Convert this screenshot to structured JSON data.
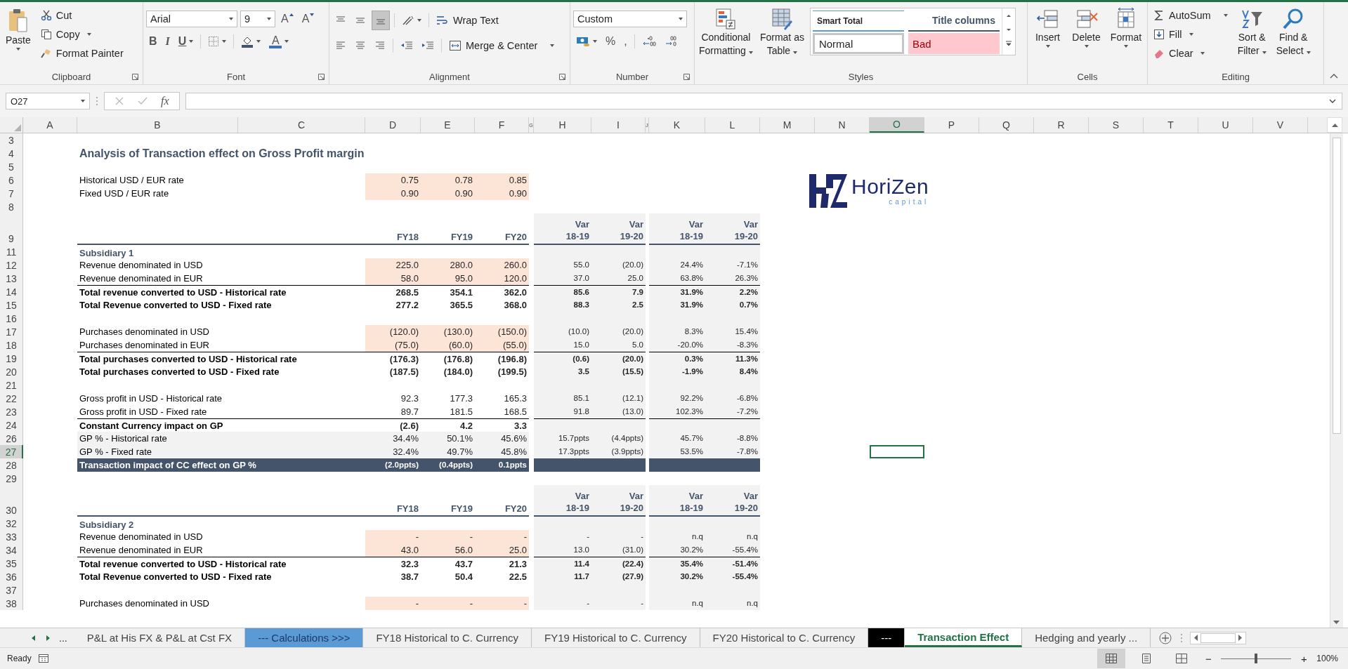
{
  "ribbon": {
    "clipboard": {
      "label": "Clipboard",
      "paste": "Paste",
      "cut": "Cut",
      "copy": "Copy",
      "painter": "Format Painter"
    },
    "font": {
      "label": "Font",
      "family": "Arial",
      "size": "9",
      "grow": "A",
      "shrink": "A",
      "bold": "B",
      "italic": "I",
      "underline": "U",
      "text_tool": "A"
    },
    "alignment": {
      "label": "Alignment",
      "valign": [
        {
          "selected": false
        },
        {
          "selected": false
        },
        {
          "selected": true
        }
      ],
      "wrap": "Wrap Text",
      "merge": "Merge & Center"
    },
    "number": {
      "label": "Number",
      "format": "Custom",
      "percent": "%",
      "comma": ","
    },
    "styles": {
      "label": "Styles",
      "conditional": [
        "Conditional",
        "Formatting"
      ],
      "table": [
        "Format as",
        "Table"
      ],
      "gallery": [
        {
          "label": "Smart Total",
          "kind": "smart"
        },
        {
          "label": "Title columns",
          "kind": "title"
        },
        {
          "label": "Normal",
          "kind": "normal"
        },
        {
          "label": "Bad",
          "kind": "bad"
        }
      ]
    },
    "cells": {
      "label": "Cells",
      "buttons": [
        "Insert",
        "Delete",
        "Format"
      ]
    },
    "editing": {
      "label": "Editing",
      "autosum": "AutoSum",
      "fill": "Fill",
      "clear": "Clear",
      "sort": [
        "Sort &",
        "Filter"
      ],
      "find": [
        "Find &",
        "Select"
      ]
    }
  },
  "formula_bar": {
    "name_box": "O27",
    "fx": "fx"
  },
  "sheet": {
    "columns": [
      {
        "label": "A",
        "selected": false
      },
      {
        "label": "B",
        "selected": false
      },
      {
        "label": "C",
        "selected": false
      },
      {
        "label": "D",
        "selected": false
      },
      {
        "label": "E",
        "selected": false
      },
      {
        "label": "F",
        "selected": false
      },
      {
        "label": "G",
        "selected": false
      },
      {
        "label": "H",
        "selected": false
      },
      {
        "label": "I",
        "selected": false
      },
      {
        "label": "J",
        "selected": false
      },
      {
        "label": "K",
        "selected": false
      },
      {
        "label": "L",
        "selected": false
      },
      {
        "label": "M",
        "selected": false
      },
      {
        "label": "N",
        "selected": false
      },
      {
        "label": "O",
        "selected": true
      },
      {
        "label": "P",
        "selected": false
      },
      {
        "label": "Q",
        "selected": false
      },
      {
        "label": "R",
        "selected": false
      },
      {
        "label": "S",
        "selected": false
      },
      {
        "label": "T",
        "selected": false
      },
      {
        "label": "U",
        "selected": false
      },
      {
        "label": "V",
        "selected": false
      }
    ],
    "logo": {
      "name": "HoriZen",
      "tagline": "capital"
    },
    "rows": [
      {
        "num": "3",
        "kind": "blank",
        "selected": false
      },
      {
        "num": "4",
        "kind": "title",
        "label": "Analysis of Transaction effect on Gross Profit margin",
        "selected": false
      },
      {
        "num": "5",
        "kind": "blank",
        "selected": false
      },
      {
        "num": "6",
        "kind": "line",
        "label": "Historical USD / EUR rate",
        "input": true,
        "selected": false,
        "values": [
          "0.75",
          "0.78",
          "0.85"
        ]
      },
      {
        "num": "7",
        "kind": "line",
        "label": "Fixed USD / EUR rate",
        "input": true,
        "selected": false,
        "values": [
          "0.90",
          "0.90",
          "0.90"
        ]
      },
      {
        "num": "8",
        "kind": "blank",
        "selected": false
      },
      {
        "num": "9",
        "kind": "header",
        "band": true,
        "selected": false,
        "years": [
          "FY18",
          "FY19",
          "FY20"
        ],
        "var_heads": [
          {
            "top": "Var",
            "bottom": "18-19"
          },
          {
            "top": "Var",
            "bottom": "19-20"
          }
        ],
        "pct_heads": [
          {
            "top": "Var",
            "bottom": "18-19"
          },
          {
            "top": "Var",
            "bottom": "19-20"
          }
        ]
      },
      {
        "num": "11",
        "kind": "section",
        "label": "Subsidiary 1",
        "band": true,
        "selected": false
      },
      {
        "num": "12",
        "kind": "line",
        "label": "Revenue denominated in USD",
        "input": true,
        "band": true,
        "selected": false,
        "values": [
          "225.0",
          "280.0",
          "260.0"
        ],
        "var": [
          "55.0",
          "(20.0)"
        ],
        "pct": [
          "24.4%",
          "-7.1%"
        ]
      },
      {
        "num": "13",
        "kind": "line",
        "label": "Revenue denominated in EUR",
        "input": true,
        "band": true,
        "selected": false,
        "values": [
          "58.0",
          "95.0",
          "120.0"
        ],
        "var": [
          "37.0",
          "25.0"
        ],
        "pct": [
          "63.8%",
          "26.3%"
        ]
      },
      {
        "num": "14",
        "kind": "line",
        "label": "Total revenue converted to USD - Historical rate",
        "bold": true,
        "rule": true,
        "band": true,
        "selected": false,
        "values": [
          "268.5",
          "354.1",
          "362.0"
        ],
        "var": [
          "85.6",
          "7.9"
        ],
        "pct": [
          "31.9%",
          "2.2%"
        ]
      },
      {
        "num": "15",
        "kind": "line",
        "label": "Total Revenue converted to USD - Fixed rate",
        "bold": true,
        "band": true,
        "selected": false,
        "values": [
          "277.2",
          "365.5",
          "368.0"
        ],
        "var": [
          "88.3",
          "2.5"
        ],
        "pct": [
          "31.9%",
          "0.7%"
        ]
      },
      {
        "num": "16",
        "kind": "blank",
        "band": true,
        "selected": false
      },
      {
        "num": "17",
        "kind": "line",
        "label": "Purchases denominated in USD",
        "input": true,
        "band": true,
        "selected": false,
        "values": [
          "(120.0)",
          "(130.0)",
          "(150.0)"
        ],
        "var": [
          "(10.0)",
          "(20.0)"
        ],
        "pct": [
          "8.3%",
          "15.4%"
        ]
      },
      {
        "num": "18",
        "kind": "line",
        "label": "Purchases denominated in EUR",
        "input": true,
        "band": true,
        "selected": false,
        "values": [
          "(75.0)",
          "(60.0)",
          "(55.0)"
        ],
        "var": [
          "15.0",
          "5.0"
        ],
        "pct": [
          "-20.0%",
          "-8.3%"
        ]
      },
      {
        "num": "19",
        "kind": "line",
        "label": "Total purchases converted to USD - Historical rate",
        "bold": true,
        "rule": true,
        "band": true,
        "selected": false,
        "values": [
          "(176.3)",
          "(176.8)",
          "(196.8)"
        ],
        "var": [
          "(0.6)",
          "(20.0)"
        ],
        "pct": [
          "0.3%",
          "11.3%"
        ]
      },
      {
        "num": "20",
        "kind": "line",
        "label": "Total purchases converted to USD - Fixed rate",
        "bold": true,
        "band": true,
        "selected": false,
        "values": [
          "(187.5)",
          "(184.0)",
          "(199.5)"
        ],
        "var": [
          "3.5",
          "(15.5)"
        ],
        "pct": [
          "-1.9%",
          "8.4%"
        ]
      },
      {
        "num": "21",
        "kind": "blank",
        "band": true,
        "selected": false
      },
      {
        "num": "22",
        "kind": "line",
        "label": "Gross profit in USD - Historical rate",
        "band": true,
        "selected": false,
        "values": [
          "92.3",
          "177.3",
          "165.3"
        ],
        "var": [
          "85.1",
          "(12.1)"
        ],
        "pct": [
          "92.2%",
          "-6.8%"
        ]
      },
      {
        "num": "23",
        "kind": "line",
        "label": "Gross profit in USD - Fixed rate",
        "band": true,
        "selected": false,
        "values": [
          "89.7",
          "181.5",
          "168.5"
        ],
        "var": [
          "91.8",
          "(13.0)"
        ],
        "pct": [
          "102.3%",
          "-7.2%"
        ]
      },
      {
        "num": "24",
        "kind": "line",
        "label": "Constant Currency impact on GP",
        "bold": true,
        "rule": true,
        "band": true,
        "selected": false,
        "values": [
          "(2.6)",
          "4.2",
          "3.3"
        ]
      },
      {
        "num": "26",
        "kind": "line",
        "label": "GP % - Historical rate",
        "shaded": true,
        "band": true,
        "selected": false,
        "values": [
          "34.4%",
          "50.1%",
          "45.6%"
        ],
        "var": [
          "15.7ppts",
          "(4.4ppts)"
        ],
        "pct": [
          "45.7%",
          "-8.8%"
        ]
      },
      {
        "num": "27",
        "kind": "line",
        "label": "GP % - Fixed rate",
        "shaded": true,
        "band": true,
        "selected": true,
        "values": [
          "32.4%",
          "49.7%",
          "45.8%"
        ],
        "var": [
          "17.3ppts",
          "(3.9ppts)"
        ],
        "pct": [
          "53.5%",
          "-7.8%"
        ]
      },
      {
        "num": "28",
        "kind": "impact",
        "label": "Transaction impact of CC effect on GP %",
        "selected": false,
        "values": [
          "(2.0ppts)",
          "(0.4ppts)",
          "0.1ppts"
        ]
      },
      {
        "num": "29",
        "kind": "blank",
        "selected": false
      },
      {
        "num": "30",
        "kind": "header",
        "band": true,
        "selected": false,
        "years": [
          "FY18",
          "FY19",
          "FY20"
        ],
        "var_heads": [
          {
            "top": "Var",
            "bottom": "18-19"
          },
          {
            "top": "Var",
            "bottom": "19-20"
          }
        ],
        "pct_heads": [
          {
            "top": "Var",
            "bottom": "18-19"
          },
          {
            "top": "Var",
            "bottom": "19-20"
          }
        ]
      },
      {
        "num": "32",
        "kind": "section",
        "label": "Subsidiary 2",
        "band": true,
        "selected": false
      },
      {
        "num": "33",
        "kind": "line",
        "label": "Revenue denominated in USD",
        "input": true,
        "band": true,
        "selected": false,
        "values": [
          "-",
          "-",
          "-"
        ],
        "var": [
          "-",
          "-"
        ],
        "pct": [
          "n.q",
          "n.q"
        ]
      },
      {
        "num": "34",
        "kind": "line",
        "label": "Revenue denominated in EUR",
        "input": true,
        "band": true,
        "selected": false,
        "values": [
          "43.0",
          "56.0",
          "25.0"
        ],
        "var": [
          "13.0",
          "(31.0)"
        ],
        "pct": [
          "30.2%",
          "-55.4%"
        ]
      },
      {
        "num": "35",
        "kind": "line",
        "label": "Total revenue converted to USD - Historical rate",
        "bold": true,
        "rule": true,
        "band": true,
        "selected": false,
        "values": [
          "32.3",
          "43.7",
          "21.3"
        ],
        "var": [
          "11.4",
          "(22.4)"
        ],
        "pct": [
          "35.4%",
          "-51.4%"
        ]
      },
      {
        "num": "36",
        "kind": "line",
        "label": "Total Revenue converted to USD - Fixed rate",
        "bold": true,
        "band": true,
        "selected": false,
        "values": [
          "38.7",
          "50.4",
          "22.5"
        ],
        "var": [
          "11.7",
          "(27.9)"
        ],
        "pct": [
          "30.2%",
          "-55.4%"
        ]
      },
      {
        "num": "37",
        "kind": "blank",
        "band": true,
        "selected": false
      },
      {
        "num": "38",
        "kind": "line",
        "label": "Purchases denominated in USD",
        "input": true,
        "band": true,
        "selected": false,
        "values": [
          "-",
          "-",
          "-"
        ],
        "var": [
          "-",
          "-"
        ],
        "pct": [
          "n.q",
          "n.q"
        ]
      }
    ]
  },
  "sheet_tabs": {
    "more": "...",
    "tabs": [
      {
        "label": "P&L at His FX & P&L at Cst FX",
        "selected": false
      },
      {
        "label": "--- Calculations >>>",
        "selected": false,
        "color": "#5b9bd5"
      },
      {
        "label": "FY18 Historical to C. Currency",
        "selected": false
      },
      {
        "label": "FY19 Historical to C. Currency",
        "selected": false
      },
      {
        "label": "FY20 Historical to C. Currency",
        "selected": false
      },
      {
        "label": "---",
        "selected": false,
        "color": "#000000"
      },
      {
        "label": "Transaction Effect",
        "selected": true
      },
      {
        "label": "Hedging and yearly ...",
        "selected": false
      }
    ]
  },
  "status_bar": {
    "text": "Ready",
    "views": [
      {
        "selected": true
      },
      {
        "selected": false
      },
      {
        "selected": false
      }
    ],
    "minus": "−",
    "plus": "+",
    "zoom": {
      "level": 0.5
    },
    "zoom_text": "100%"
  }
}
